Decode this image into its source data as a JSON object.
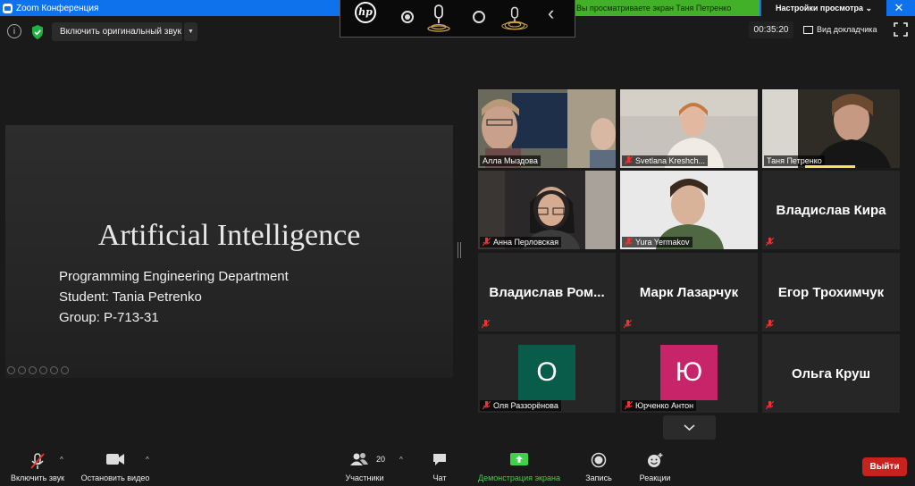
{
  "window": {
    "title": "Zoom Конференция"
  },
  "banner": {
    "sharing_text": "Вы просматриваете экран Таня Петренко",
    "view_options": "Настройки просмотра ⌄"
  },
  "top_controls": {
    "original_sound": "Включить оригинальный звук",
    "timer": "00:35:20",
    "speaker_view": "Вид докладчика"
  },
  "slide": {
    "title": "Artificial Intelligence",
    "lines": [
      "Programming Engineering Department",
      "Student: Tania Petrenko",
      "Group: P-713-31"
    ]
  },
  "participants": [
    {
      "name": "Алла Мыздова",
      "video": true,
      "muted": false,
      "active": true
    },
    {
      "name": "Svetlana Kreshch...",
      "video": true,
      "muted": true
    },
    {
      "name": "Таня Петренко",
      "video": true,
      "muted": false
    },
    {
      "name": "Анна Перловская",
      "video": true,
      "muted": true
    },
    {
      "name": "Yura Yermakov",
      "video": true,
      "muted": true
    },
    {
      "name": "Владислав Кира",
      "video": false,
      "muted": true
    },
    {
      "name": "Владислав  Ром...",
      "video": false,
      "muted": true
    },
    {
      "name": "Марк Лазарчук",
      "video": false,
      "muted": true
    },
    {
      "name": "Егор Трохимчук",
      "video": false,
      "muted": true
    },
    {
      "name": "Оля Раззорёнова",
      "video": false,
      "muted": true,
      "avatar_letter": "О",
      "avatar_color": "#0a5c4a"
    },
    {
      "name": "Юрченко Антон",
      "video": false,
      "muted": true,
      "avatar_letter": "Ю",
      "avatar_color": "#c8246a"
    },
    {
      "name": "Ольга Круш",
      "video": false,
      "muted": true
    }
  ],
  "toolbar": {
    "unmute": "Включить звук",
    "stop_video": "Остановить видео",
    "participants": "Участники",
    "participants_count": "20",
    "chat": "Чат",
    "share_screen": "Демонстрация экрана",
    "record": "Запись",
    "reactions": "Реакции",
    "leave": "Выйти"
  },
  "colors": {
    "zoom_blue": "#0e72ed",
    "share_green": "#43b02a",
    "leave_red": "#c8221f",
    "active_speaker": "#f1e35b"
  }
}
